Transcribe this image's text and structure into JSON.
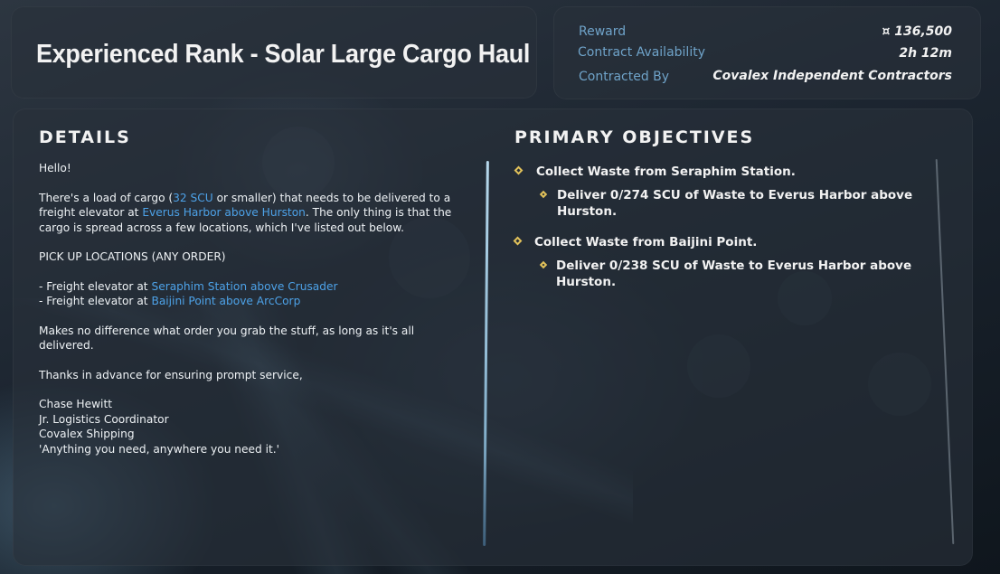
{
  "contract": {
    "title": "Experienced Rank - Solar Large Cargo Haul"
  },
  "info": {
    "reward_label": "Reward",
    "reward_value": "¤ 136,500",
    "availability_label": "Contract Availability",
    "availability_value": "2h 12m",
    "contracted_by_label": "Contracted By",
    "contracted_by_value": "Covalex Independent Contractors"
  },
  "details": {
    "heading": "DETAILS",
    "greeting": "Hello!",
    "p1_part1": "There's a load of cargo (",
    "p1_link1": "32 SCU",
    "p1_part2": " or smaller) that needs to be delivered to a freight elevator at ",
    "p1_link2": "Everus Harbor above Hurston",
    "p1_part3": ". The only thing is that the cargo is spread across a few locations, which I've listed out below.",
    "pickup_heading": "PICK UP LOCATIONS (ANY ORDER)",
    "pickup1_prefix": "- Freight elevator at ",
    "pickup1_link": "Seraphim Station above Crusader",
    "pickup2_prefix": "- Freight elevator at ",
    "pickup2_link": "Baijini Point above ArcCorp",
    "p2": "Makes no difference what order you grab the stuff, as long as it's all delivered.",
    "p3": "Thanks in advance for ensuring prompt service,",
    "sig_name": "Chase Hewitt",
    "sig_title": "Jr. Logistics Coordinator",
    "sig_company": "Covalex Shipping",
    "sig_motto": "'Anything you need, anywhere you need it.'"
  },
  "objectives": {
    "heading": "PRIMARY OBJECTIVES",
    "items": [
      {
        "text": "Collect Waste from Seraphim Station.",
        "sub": "Deliver 0/274 SCU of Waste to Everus Harbor above Hurston."
      },
      {
        "text": "Collect Waste from Baijini Point.",
        "sub": "Deliver 0/238 SCU of Waste to Everus Harbor above Hurston."
      }
    ]
  },
  "colors": {
    "accent_link": "#4da2e8",
    "label_blue": "#6fa3c9",
    "objective_diamond": "#e2c25a"
  }
}
